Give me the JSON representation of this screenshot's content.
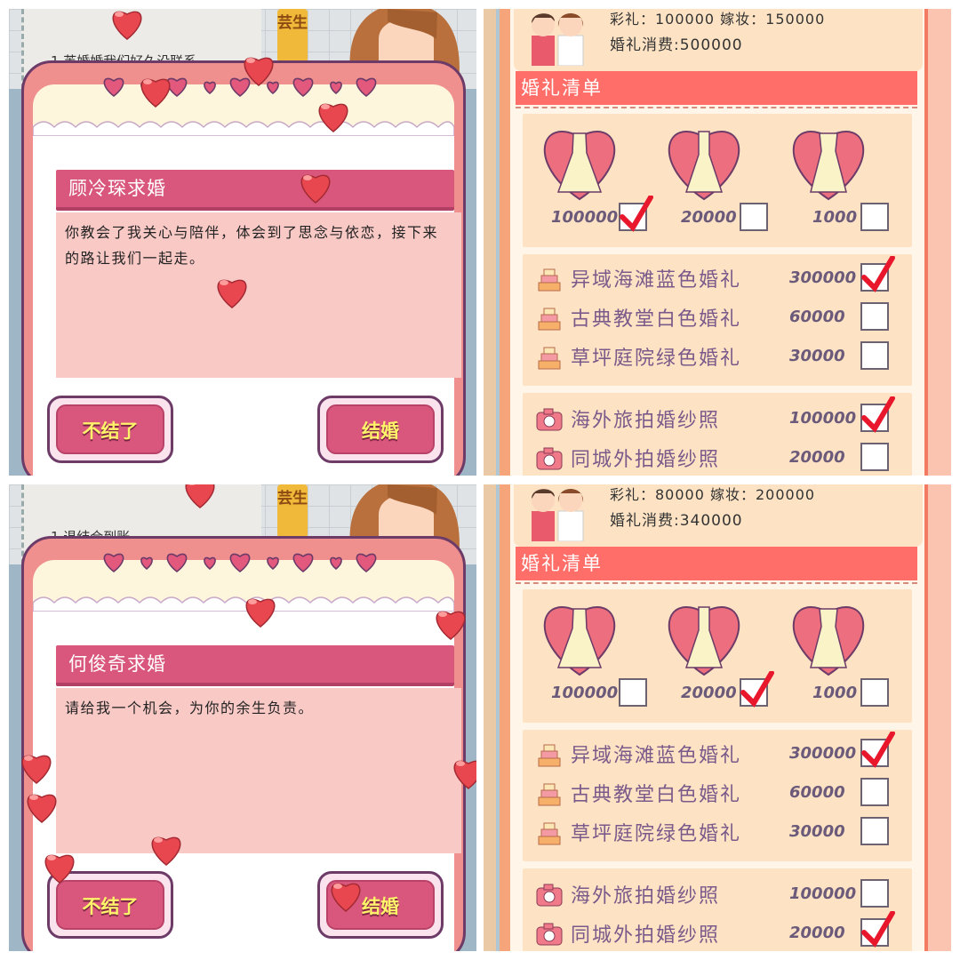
{
  "panels": [
    {
      "background_text": "1.芙婚婚我们好久没联系",
      "tag": "芸生",
      "dialog_title": "顾冷琛求婚",
      "dialog_body": "你教会了我关心与陪伴，体会到了思念与依恋，接下来的路让我们一起走。",
      "reject_label": "不结了",
      "accept_label": "结婚"
    },
    {
      "background_text": "1.退结合到账",
      "tag": "芸生",
      "dialog_title": "何俊奇求婚",
      "dialog_body": "请给我一个机会，为你的余生负责。",
      "reject_label": "不结了",
      "accept_label": "结婚"
    }
  ],
  "checklists": [
    {
      "stat_line": "彩礼：100000 嫁妆：150000",
      "cost_line": "婚礼消费:500000",
      "section_title": "婚礼清单",
      "dresses": [
        {
          "price": "100000",
          "checked": true
        },
        {
          "price": "20000",
          "checked": false
        },
        {
          "price": "1000",
          "checked": false
        }
      ],
      "venues": [
        {
          "label": "异域海滩蓝色婚礼",
          "price": "300000",
          "checked": true
        },
        {
          "label": "古典教堂白色婚礼",
          "price": "60000",
          "checked": false
        },
        {
          "label": "草坪庭院绿色婚礼",
          "price": "30000",
          "checked": false
        }
      ],
      "photos": [
        {
          "label": "海外旅拍婚纱照",
          "price": "100000",
          "checked": true
        },
        {
          "label": "同城外拍婚纱照",
          "price": "20000",
          "checked": false
        }
      ]
    },
    {
      "stat_line": "彩礼：80000 嫁妆：200000",
      "cost_line": "婚礼消费:340000",
      "section_title": "婚礼清单",
      "dresses": [
        {
          "price": "100000",
          "checked": false
        },
        {
          "price": "20000",
          "checked": true
        },
        {
          "price": "1000",
          "checked": false
        }
      ],
      "venues": [
        {
          "label": "异域海滩蓝色婚礼",
          "price": "300000",
          "checked": true
        },
        {
          "label": "古典教堂白色婚礼",
          "price": "60000",
          "checked": false
        },
        {
          "label": "草坪庭院绿色婚礼",
          "price": "30000",
          "checked": false
        }
      ],
      "photos": [
        {
          "label": "海外旅拍婚纱照",
          "price": "100000",
          "checked": false
        },
        {
          "label": "同城外拍婚纱照",
          "price": "20000",
          "checked": true
        }
      ]
    }
  ],
  "colors": {
    "accent": "#d9577d",
    "section": "#ff6e68",
    "tick": "#e8172c",
    "heart": "#e8474f"
  },
  "icons": [
    "heart-icon",
    "dress-icon",
    "cake-icon",
    "camera-icon",
    "couple-avatar",
    "checkmark-icon"
  ]
}
